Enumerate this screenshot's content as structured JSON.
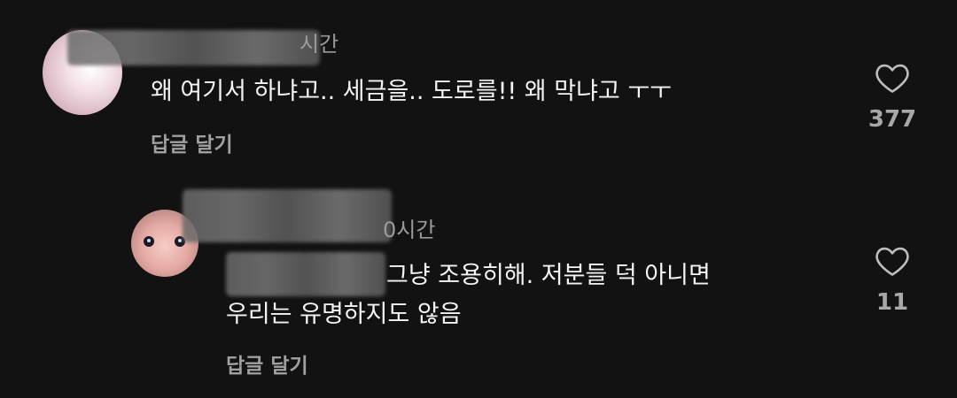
{
  "comments": [
    {
      "time_fragment": "시간",
      "text": "왜 여기서 하냐고.. 세금을.. 도로를!! 왜 막냐고 ㅜㅜ",
      "reply_label": "답글 달기",
      "like_count": "377",
      "like_icon": "heart-icon"
    },
    {
      "time_fragment": "0시간",
      "text_line1": "그냥 조용히해. 저분들 덕 아니면",
      "text_line2": "우리는 유명하지도 않음",
      "reply_label": "답글 달기",
      "like_count": "11",
      "like_icon": "heart-icon"
    }
  ]
}
